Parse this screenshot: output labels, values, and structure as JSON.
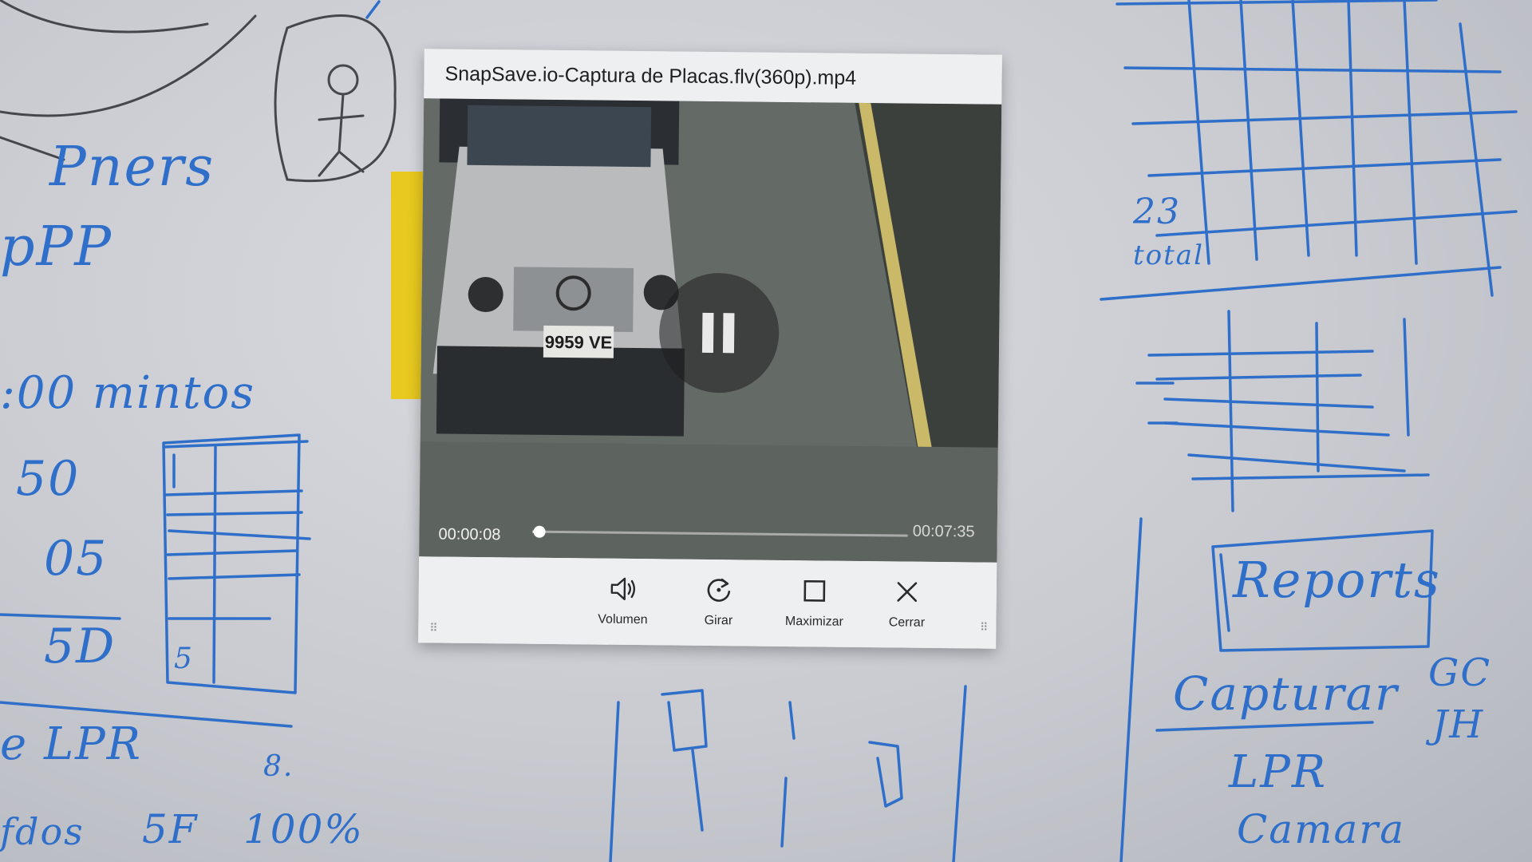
{
  "player": {
    "title": "SnapSave.io-Captura de Placas.flv(360p).mp4",
    "time_current": "00:00:08",
    "time_total": "00:07:35",
    "progress_fraction": 0.018,
    "state": "playing",
    "plate_text": "9959 VE",
    "controls": [
      {
        "label": "Volumen",
        "icon": "volume-icon"
      },
      {
        "label": "Girar",
        "icon": "rotate-icon"
      },
      {
        "label": "Maximizar",
        "icon": "maximize-icon"
      },
      {
        "label": "Cerrar",
        "icon": "close-icon"
      }
    ]
  },
  "whiteboard": {
    "notes": [
      "Pners",
      "pPP",
      ":00 mintos",
      "50",
      "05",
      "5D",
      "5",
      "e LPR",
      "8.",
      "fdos",
      "5F",
      "100%",
      "23",
      "total",
      "Reports",
      "Capturar",
      "GC",
      "JH",
      "LPR",
      "Camara"
    ]
  },
  "colors": {
    "ink": "#2f6fc9",
    "window_bg": "#eeeff1",
    "sticky_note": "#e8c91f"
  }
}
